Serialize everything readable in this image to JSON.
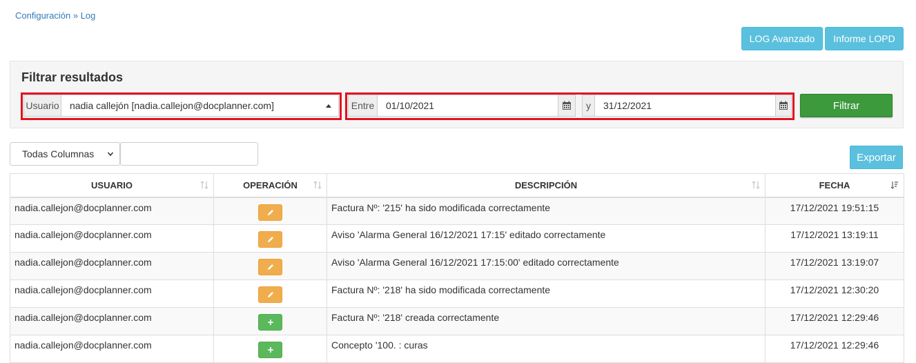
{
  "breadcrumb": {
    "parent": "Configuración",
    "separator": "»",
    "current": "Log"
  },
  "top_buttons": {
    "log_avanzado": "LOG Avanzado",
    "informe_lopd": "Informe LOPD"
  },
  "filter": {
    "title": "Filtrar resultados",
    "usuario_label": "Usuario",
    "usuario_value": "nadia callejón [nadia.callejon@docplanner.com]",
    "entre_label": "Entre",
    "date_from": "01/10/2021",
    "y_label": "y",
    "date_to": "31/12/2021",
    "filtrar_button": "Filtrar"
  },
  "toolbar": {
    "column_select_value": "Todas Columnas",
    "search_value": "",
    "export_button": "Exportar"
  },
  "table": {
    "headers": [
      "USUARIO",
      "OPERACIÓN",
      "DESCRIPCIÓN",
      "FECHA"
    ],
    "rows": [
      {
        "usuario": "nadia.callejon@docplanner.com",
        "op": "edit",
        "descripcion": "Factura Nº: '215' ha sido modificada correctamente",
        "fecha": "17/12/2021 19:51:15"
      },
      {
        "usuario": "nadia.callejon@docplanner.com",
        "op": "edit",
        "descripcion": "Aviso 'Alarma General 16/12/2021 17:15' editado correctamente",
        "fecha": "17/12/2021 13:19:11"
      },
      {
        "usuario": "nadia.callejon@docplanner.com",
        "op": "edit",
        "descripcion": "Aviso 'Alarma General 16/12/2021 17:15:00' editado correctamente",
        "fecha": "17/12/2021 13:19:07"
      },
      {
        "usuario": "nadia.callejon@docplanner.com",
        "op": "edit",
        "descripcion": "Factura Nº: '218' ha sido modificada correctamente",
        "fecha": "17/12/2021 12:30:20"
      },
      {
        "usuario": "nadia.callejon@docplanner.com",
        "op": "add",
        "descripcion": "Factura Nº: '218' creada correctamente",
        "fecha": "17/12/2021 12:29:46"
      },
      {
        "usuario": "nadia.callejon@docplanner.com",
        "op": "add",
        "descripcion": "Concepto '100. : curas",
        "fecha": "17/12/2021 12:29:46"
      }
    ]
  },
  "colors": {
    "info": "#5bc0de",
    "success": "#3c9a3c",
    "warning": "#f0ad4e",
    "add": "#5cb85c",
    "highlight": "#e3101e",
    "link": "#337ab7"
  },
  "icons": {
    "calendar": "calendar-icon",
    "edit": "pencil-icon",
    "add": "plus-icon",
    "sort": "sort-icon",
    "sort_desc": "sort-desc-icon",
    "dropdown": "caret-up-icon",
    "chevron": "chevron-down-icon"
  }
}
